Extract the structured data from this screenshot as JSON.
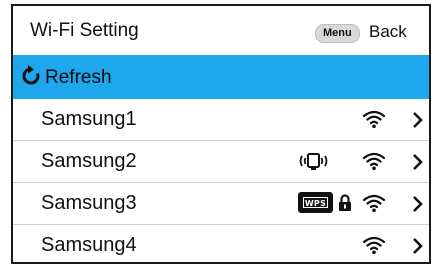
{
  "header": {
    "title": "Wi-Fi Setting",
    "menu_button": "Menu",
    "back_label": "Back"
  },
  "refresh": {
    "label": "Refresh",
    "icon": "refresh-icon",
    "background": "#1ea7ec"
  },
  "networks": [
    {
      "ssid": "Samsung1",
      "icons": [
        "wifi-signal-icon",
        "chevron-right-icon"
      ]
    },
    {
      "ssid": "Samsung2",
      "icons": [
        "device-vibrate-icon",
        "wifi-signal-icon",
        "chevron-right-icon"
      ]
    },
    {
      "ssid": "Samsung3",
      "wps_label": "WPS",
      "icons": [
        "wps-icon",
        "lock-icon",
        "wifi-signal-icon",
        "chevron-right-icon"
      ]
    },
    {
      "ssid": "Samsung4",
      "icons": [
        "wifi-signal-icon",
        "chevron-right-icon"
      ]
    }
  ]
}
